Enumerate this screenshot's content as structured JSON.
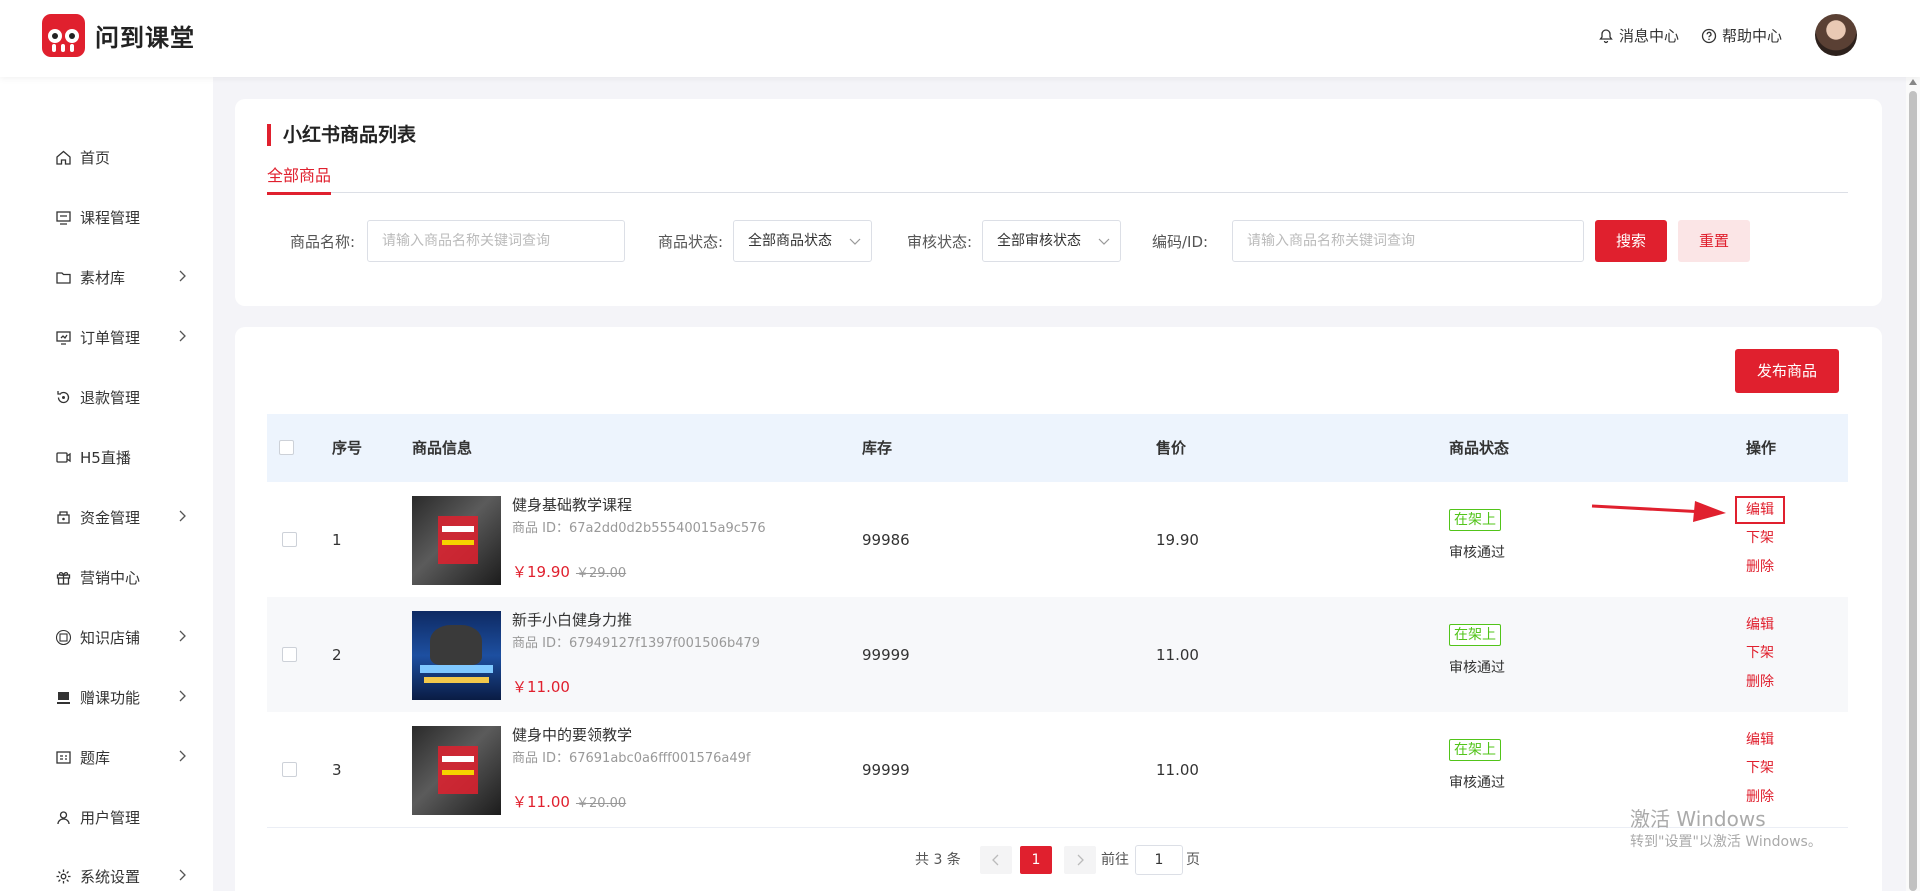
{
  "header": {
    "brand": "问到课堂",
    "messages": "消息中心",
    "help": "帮助中心"
  },
  "sidebar": {
    "items": [
      {
        "label": "首页",
        "icon": "home-icon"
      },
      {
        "label": "课程管理",
        "icon": "course-icon"
      },
      {
        "label": "素材库",
        "icon": "folder-icon"
      },
      {
        "label": "订单管理",
        "icon": "order-icon"
      },
      {
        "label": "退款管理",
        "icon": "refund-icon"
      },
      {
        "label": "H5直播",
        "icon": "live-icon"
      },
      {
        "label": "资金管理",
        "icon": "wallet-icon"
      },
      {
        "label": "营销中心",
        "icon": "gift-icon"
      },
      {
        "label": "知识店铺",
        "icon": "shop-icon"
      },
      {
        "label": "赠课功能",
        "icon": "gift-course-icon"
      },
      {
        "label": "题库",
        "icon": "question-bank-icon"
      },
      {
        "label": "用户管理",
        "icon": "user-icon"
      },
      {
        "label": "系统设置",
        "icon": "settings-icon"
      }
    ]
  },
  "page": {
    "title": "小红书商品列表",
    "tab": "全部商品"
  },
  "filters": {
    "name_label": "商品名称:",
    "name_placeholder": "请输入商品名称关键词查询",
    "status_label": "商品状态:",
    "status_value": "全部商品状态",
    "audit_label": "审核状态:",
    "audit_value": "全部审核状态",
    "code_label": "编码/ID:",
    "code_placeholder": "请输入商品名称关键词查询",
    "search": "搜索",
    "reset": "重置"
  },
  "table": {
    "publish": "发布商品",
    "headers": {
      "index": "序号",
      "info": "商品信息",
      "stock": "库存",
      "price": "售价",
      "status": "商品状态",
      "ops": "操作"
    },
    "rows": [
      {
        "index": "1",
        "name": "健身基础教学课程",
        "id": "商品 ID：67a2dd0d2b55540015a9c576",
        "price": "￥19.90",
        "old_price": "￥29.00",
        "stock": "99986",
        "sale": "19.90",
        "status": "在架上",
        "audit": "审核通过"
      },
      {
        "index": "2",
        "name": "新手小白健身力推",
        "id": "商品 ID：67949127f1397f001506b479",
        "price": "￥11.00",
        "old_price": "",
        "stock": "99999",
        "sale": "11.00",
        "status": "在架上",
        "audit": "审核通过"
      },
      {
        "index": "3",
        "name": "健身中的要领教学",
        "id": "商品 ID：67691abc0a6fff001576a49f",
        "price": "￥11.00",
        "old_price": "￥20.00",
        "stock": "99999",
        "sale": "11.00",
        "status": "在架上",
        "audit": "审核通过"
      }
    ],
    "ops": {
      "edit": "编辑",
      "off": "下架",
      "delete": "删除"
    }
  },
  "pagination": {
    "total": "共 3 条",
    "current": "1",
    "goto": "前往",
    "goto_value": "1",
    "page_unit": "页"
  },
  "watermark": {
    "line1": "激活 Windows",
    "line2": "转到\"设置\"以激活 Windows。"
  },
  "colors": {
    "accent": "#e0202e",
    "success": "#52c41a"
  }
}
